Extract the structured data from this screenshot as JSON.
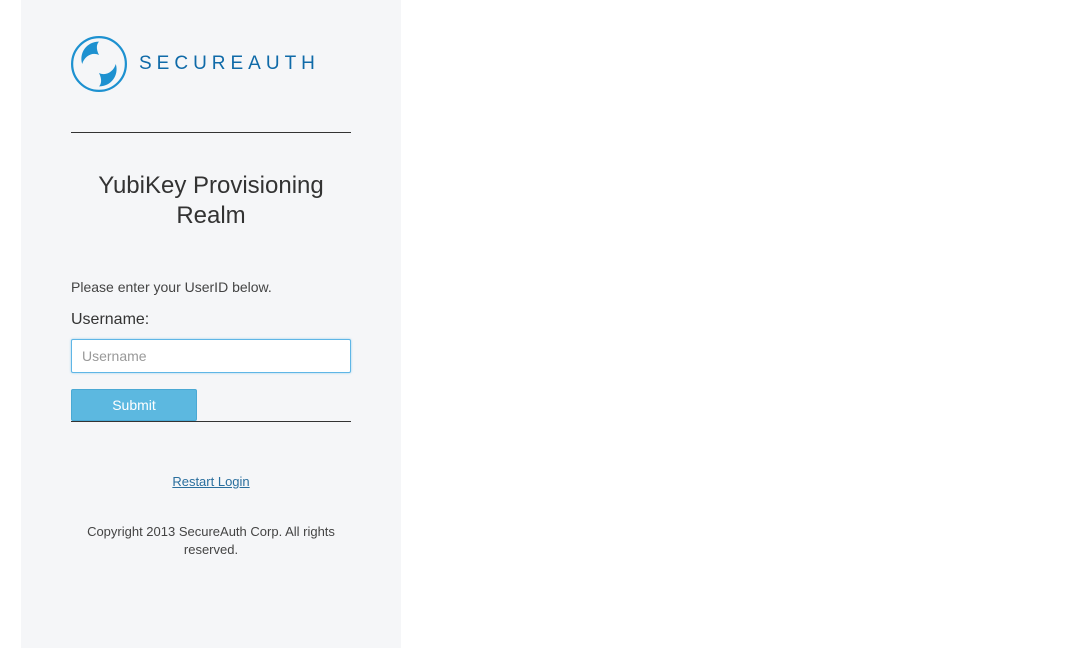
{
  "brand": {
    "name": "SECUREAUTH"
  },
  "page": {
    "title": "YubiKey Provisioning Realm",
    "hint": "Please enter your UserID below."
  },
  "form": {
    "username_label": "Username:",
    "username_placeholder": "Username",
    "username_value": "",
    "submit_label": "Submit"
  },
  "footer": {
    "restart_label": "Restart Login",
    "copyright": "Copyright 2013 SecureAuth Corp. All rights reserved."
  }
}
